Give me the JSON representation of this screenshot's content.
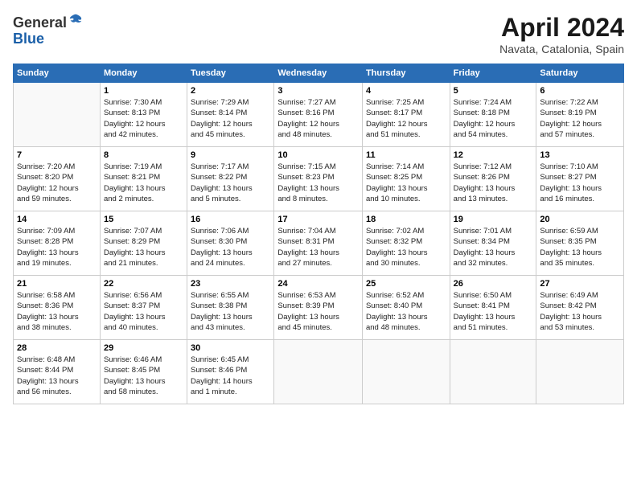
{
  "header": {
    "logo_line1": "General",
    "logo_line2": "Blue",
    "title": "April 2024",
    "location": "Navata, Catalonia, Spain"
  },
  "days_of_week": [
    "Sunday",
    "Monday",
    "Tuesday",
    "Wednesday",
    "Thursday",
    "Friday",
    "Saturday"
  ],
  "weeks": [
    [
      {
        "day": "",
        "info": ""
      },
      {
        "day": "1",
        "info": "Sunrise: 7:30 AM\nSunset: 8:13 PM\nDaylight: 12 hours\nand 42 minutes."
      },
      {
        "day": "2",
        "info": "Sunrise: 7:29 AM\nSunset: 8:14 PM\nDaylight: 12 hours\nand 45 minutes."
      },
      {
        "day": "3",
        "info": "Sunrise: 7:27 AM\nSunset: 8:16 PM\nDaylight: 12 hours\nand 48 minutes."
      },
      {
        "day": "4",
        "info": "Sunrise: 7:25 AM\nSunset: 8:17 PM\nDaylight: 12 hours\nand 51 minutes."
      },
      {
        "day": "5",
        "info": "Sunrise: 7:24 AM\nSunset: 8:18 PM\nDaylight: 12 hours\nand 54 minutes."
      },
      {
        "day": "6",
        "info": "Sunrise: 7:22 AM\nSunset: 8:19 PM\nDaylight: 12 hours\nand 57 minutes."
      }
    ],
    [
      {
        "day": "7",
        "info": "Sunrise: 7:20 AM\nSunset: 8:20 PM\nDaylight: 12 hours\nand 59 minutes."
      },
      {
        "day": "8",
        "info": "Sunrise: 7:19 AM\nSunset: 8:21 PM\nDaylight: 13 hours\nand 2 minutes."
      },
      {
        "day": "9",
        "info": "Sunrise: 7:17 AM\nSunset: 8:22 PM\nDaylight: 13 hours\nand 5 minutes."
      },
      {
        "day": "10",
        "info": "Sunrise: 7:15 AM\nSunset: 8:23 PM\nDaylight: 13 hours\nand 8 minutes."
      },
      {
        "day": "11",
        "info": "Sunrise: 7:14 AM\nSunset: 8:25 PM\nDaylight: 13 hours\nand 10 minutes."
      },
      {
        "day": "12",
        "info": "Sunrise: 7:12 AM\nSunset: 8:26 PM\nDaylight: 13 hours\nand 13 minutes."
      },
      {
        "day": "13",
        "info": "Sunrise: 7:10 AM\nSunset: 8:27 PM\nDaylight: 13 hours\nand 16 minutes."
      }
    ],
    [
      {
        "day": "14",
        "info": "Sunrise: 7:09 AM\nSunset: 8:28 PM\nDaylight: 13 hours\nand 19 minutes."
      },
      {
        "day": "15",
        "info": "Sunrise: 7:07 AM\nSunset: 8:29 PM\nDaylight: 13 hours\nand 21 minutes."
      },
      {
        "day": "16",
        "info": "Sunrise: 7:06 AM\nSunset: 8:30 PM\nDaylight: 13 hours\nand 24 minutes."
      },
      {
        "day": "17",
        "info": "Sunrise: 7:04 AM\nSunset: 8:31 PM\nDaylight: 13 hours\nand 27 minutes."
      },
      {
        "day": "18",
        "info": "Sunrise: 7:02 AM\nSunset: 8:32 PM\nDaylight: 13 hours\nand 30 minutes."
      },
      {
        "day": "19",
        "info": "Sunrise: 7:01 AM\nSunset: 8:34 PM\nDaylight: 13 hours\nand 32 minutes."
      },
      {
        "day": "20",
        "info": "Sunrise: 6:59 AM\nSunset: 8:35 PM\nDaylight: 13 hours\nand 35 minutes."
      }
    ],
    [
      {
        "day": "21",
        "info": "Sunrise: 6:58 AM\nSunset: 8:36 PM\nDaylight: 13 hours\nand 38 minutes."
      },
      {
        "day": "22",
        "info": "Sunrise: 6:56 AM\nSunset: 8:37 PM\nDaylight: 13 hours\nand 40 minutes."
      },
      {
        "day": "23",
        "info": "Sunrise: 6:55 AM\nSunset: 8:38 PM\nDaylight: 13 hours\nand 43 minutes."
      },
      {
        "day": "24",
        "info": "Sunrise: 6:53 AM\nSunset: 8:39 PM\nDaylight: 13 hours\nand 45 minutes."
      },
      {
        "day": "25",
        "info": "Sunrise: 6:52 AM\nSunset: 8:40 PM\nDaylight: 13 hours\nand 48 minutes."
      },
      {
        "day": "26",
        "info": "Sunrise: 6:50 AM\nSunset: 8:41 PM\nDaylight: 13 hours\nand 51 minutes."
      },
      {
        "day": "27",
        "info": "Sunrise: 6:49 AM\nSunset: 8:42 PM\nDaylight: 13 hours\nand 53 minutes."
      }
    ],
    [
      {
        "day": "28",
        "info": "Sunrise: 6:48 AM\nSunset: 8:44 PM\nDaylight: 13 hours\nand 56 minutes."
      },
      {
        "day": "29",
        "info": "Sunrise: 6:46 AM\nSunset: 8:45 PM\nDaylight: 13 hours\nand 58 minutes."
      },
      {
        "day": "30",
        "info": "Sunrise: 6:45 AM\nSunset: 8:46 PM\nDaylight: 14 hours\nand 1 minute."
      },
      {
        "day": "",
        "info": ""
      },
      {
        "day": "",
        "info": ""
      },
      {
        "day": "",
        "info": ""
      },
      {
        "day": "",
        "info": ""
      }
    ]
  ]
}
